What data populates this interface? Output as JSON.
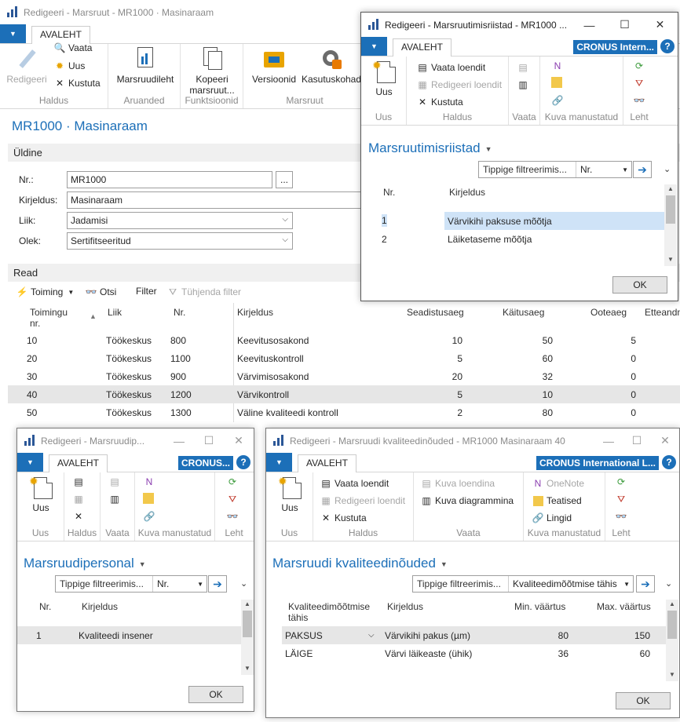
{
  "main": {
    "title": "Redigeeri - Marsruut - MR1000 · Masinaraam",
    "tab": "AVALEHT",
    "ribbon": {
      "edit": "Redigeeri",
      "view": "Vaata",
      "new": "Uus",
      "delete": "Kustuta",
      "group_manage": "Haldus",
      "route_sheet": "Marsruudileht",
      "group_reports": "Aruanded",
      "copy_route_l1": "Kopeeri",
      "copy_route_l2": "marsruut...",
      "group_functions": "Funktsioonid",
      "versions": "Versioonid",
      "where_used": "Kasutuskohad",
      "group_route": "Marsruut"
    },
    "page_title": "MR1000 · Masinaraam",
    "general": {
      "tab": "Üldine",
      "no_label": "Nr.:",
      "no_value": "MR1000",
      "lookup": "...",
      "desc_label": "Kirjeldus:",
      "desc_value": "Masinaraam",
      "type_label": "Liik:",
      "type_value": "Jadamisi",
      "status_label": "Olek:",
      "status_value": "Sertifitseeritud"
    },
    "lines": {
      "tab": "Read",
      "toolbar": {
        "action": "Toiming",
        "find": "Otsi",
        "filter": "Filter",
        "clear": "Tühjenda filter"
      },
      "headers": {
        "op_l1": "Toimingu",
        "op_l2": "nr.",
        "type": "Liik",
        "no": "Nr.",
        "desc": "Kirjeldus",
        "setup": "Seadistusaeg",
        "run": "Käitusaeg",
        "wait": "Ooteaeg",
        "move": "Etteandm"
      },
      "rows": [
        {
          "op": "10",
          "type": "Töökeskus",
          "no": "800",
          "desc": "Keevitusosakond",
          "setup": "10",
          "run": "50",
          "wait": "5"
        },
        {
          "op": "20",
          "type": "Töökeskus",
          "no": "1100",
          "desc": "Keevituskontroll",
          "setup": "5",
          "run": "60",
          "wait": "0"
        },
        {
          "op": "30",
          "type": "Töökeskus",
          "no": "900",
          "desc": "Värvimisosakond",
          "setup": "20",
          "run": "32",
          "wait": "0"
        },
        {
          "op": "40",
          "type": "Töökeskus",
          "no": "1200",
          "desc": "Värvikontroll",
          "setup": "5",
          "run": "10",
          "wait": "0"
        },
        {
          "op": "50",
          "type": "Töökeskus",
          "no": "1300",
          "desc": "Väline kvaliteedi kontroll",
          "setup": "2",
          "run": "80",
          "wait": "0"
        }
      ]
    }
  },
  "tools": {
    "title": "Redigeeri - Marsruutimisriistad - MR1000 ...",
    "tab": "AVALEHT",
    "company": "CRONUS Intern...",
    "ribbon": {
      "new": "Uus",
      "group_new": "Uus",
      "view_list": "Vaata loendit",
      "edit_list": "Redigeeri loendit",
      "delete": "Kustuta",
      "group_manage": "Haldus",
      "group_view": "Vaata",
      "group_attached": "Kuva manustatud",
      "group_page": "Leht"
    },
    "list_title": "Marsruutimisriistad",
    "filter_placeholder": "Tippige filtreerimis...",
    "filter_field": "Nr.",
    "headers": {
      "no": "Nr.",
      "desc": "Kirjeldus"
    },
    "rows": [
      {
        "no": "1",
        "desc": "Värvikihi paksuse mõõtja"
      },
      {
        "no": "2",
        "desc": "Läiketaseme mõõtja"
      }
    ],
    "ok": "OK"
  },
  "personnel": {
    "title": "Redigeeri - Marsruudip...",
    "tab": "AVALEHT",
    "company": "CRONUS...",
    "ribbon": {
      "new": "Uus",
      "group_new": "Uus",
      "group_manage": "Haldus",
      "group_view": "Vaata",
      "group_attached": "Kuva manustatud",
      "group_page": "Leht"
    },
    "list_title": "Marsruudipersonal",
    "filter_placeholder": "Tippige filtreerimis...",
    "filter_field": "Nr.",
    "headers": {
      "no": "Nr.",
      "desc": "Kirjeldus"
    },
    "rows": [
      {
        "no": "1",
        "desc": "Kvaliteedi insener"
      }
    ],
    "ok": "OK"
  },
  "quality": {
    "title": "Redigeeri - Marsruudi kvaliteedinõuded - MR1000 Masinaraam 40",
    "tab": "AVALEHT",
    "company": "CRONUS International L...",
    "ribbon": {
      "new": "Uus",
      "group_new": "Uus",
      "view_list": "Vaata loendit",
      "edit_list": "Redigeeri loendit",
      "delete": "Kustuta",
      "group_manage": "Haldus",
      "show_list": "Kuva loendina",
      "show_chart": "Kuva diagrammina",
      "group_view": "Vaata",
      "onenote": "OneNote",
      "notes": "Teatised",
      "links": "Lingid",
      "group_attached": "Kuva manustatud",
      "group_page": "Leht"
    },
    "list_title": "Marsruudi kvaliteedinõuded",
    "filter_placeholder": "Tippige filtreerimis...",
    "filter_field": "Kvaliteedimõõtmise tähis",
    "headers": {
      "code_l1": "Kvaliteedimõõtmise",
      "code_l2": "tähis",
      "desc": "Kirjeldus",
      "min": "Min. väärtus",
      "max": "Max. väärtus"
    },
    "rows": [
      {
        "code": "PAKSUS",
        "desc": "Värvikihi pakus (µm)",
        "min": "80",
        "max": "150"
      },
      {
        "code": "LÄIGE",
        "desc": "Värvi läikeaste (ühik)",
        "min": "36",
        "max": "60"
      }
    ],
    "ok": "OK"
  },
  "colors": {
    "accent": "#1c6fb8",
    "selected_row": "#e6e6e6",
    "highlight": "#cfe3f7"
  }
}
